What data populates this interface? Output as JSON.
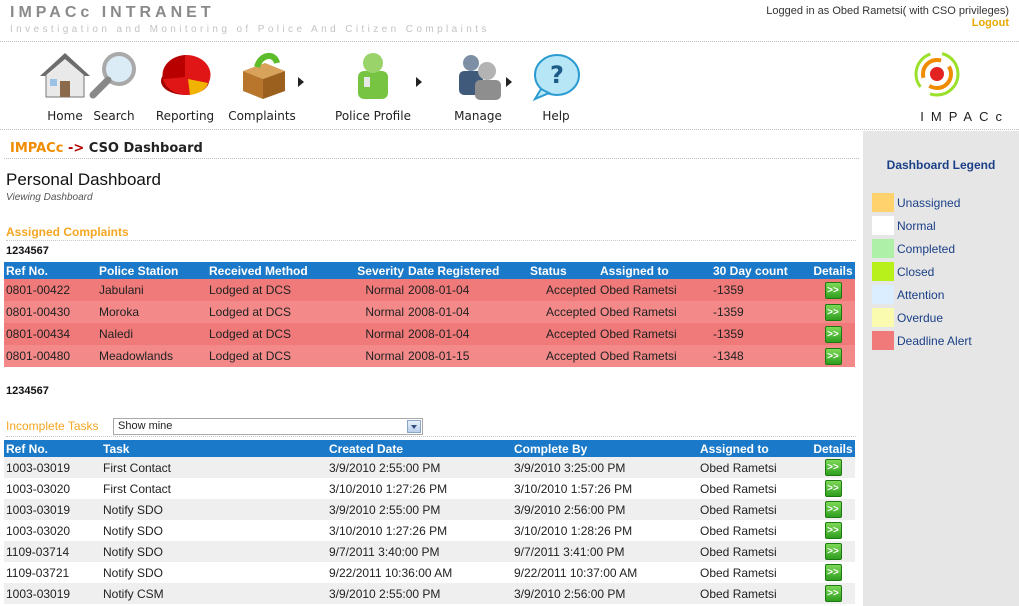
{
  "header": {
    "app_title": "IMPACc INTRANET",
    "app_subtitle": "Investigation and Monitoring of Police And Citizen Complaints",
    "login_info": "Logged in as Obed Rametsi( with CSO privileges)",
    "logout_label": "Logout"
  },
  "nav": {
    "items": [
      {
        "label": "Home",
        "icon": "house-icon"
      },
      {
        "label": "Search",
        "icon": "magnifier-icon"
      },
      {
        "label": "Reporting",
        "icon": "pie-chart-icon"
      },
      {
        "label": "Complaints",
        "icon": "box-icon"
      },
      {
        "label": "Police Profile",
        "icon": "officer-icon"
      },
      {
        "label": "Manage",
        "icon": "users-icon"
      },
      {
        "label": "Help",
        "icon": "help-bubble-icon"
      }
    ],
    "brand_text": "IMPACc"
  },
  "breadcrumb": {
    "root": "IMPACc",
    "arrow": "->",
    "current": "CSO Dashboard"
  },
  "page": {
    "title": "Personal Dashboard",
    "subtitle": "Viewing Dashboard"
  },
  "assigned": {
    "section_title": "Assigned Complaints",
    "pager_top": "1234567",
    "pager_bottom": "1234567",
    "columns": [
      "Ref No.",
      "Police Station",
      "Received Method",
      "Severity",
      "Date Registered",
      "Status",
      "Assigned to",
      "30 Day count",
      "Details"
    ],
    "rows": [
      {
        "ref": "0801-00422",
        "station": "Jabulani",
        "method": "Lodged at DCS",
        "severity": "Normal",
        "date": "2008-01-04",
        "status": "Accepted",
        "assigned": "Obed Rametsi",
        "count": "-1359",
        "details": ">>"
      },
      {
        "ref": "0801-00430",
        "station": "Moroka",
        "method": "Lodged at DCS",
        "severity": "Normal",
        "date": "2008-01-04",
        "status": "Accepted",
        "assigned": "Obed Rametsi",
        "count": "-1359",
        "details": ">>"
      },
      {
        "ref": "0801-00434",
        "station": "Naledi",
        "method": "Lodged at DCS",
        "severity": "Normal",
        "date": "2008-01-04",
        "status": "Accepted",
        "assigned": "Obed Rametsi",
        "count": "-1359",
        "details": ">>"
      },
      {
        "ref": "0801-00480",
        "station": "Meadowlands",
        "method": "Lodged at DCS",
        "severity": "Normal",
        "date": "2008-01-15",
        "status": "Accepted",
        "assigned": "Obed Rametsi",
        "count": "-1348",
        "details": ">>"
      }
    ]
  },
  "tasks": {
    "section_title": "Incomplete Tasks",
    "filter_value": "Show mine",
    "columns": [
      "Ref No.",
      "Task",
      "Created Date",
      "Complete By",
      "Assigned to",
      "Details"
    ],
    "rows": [
      {
        "ref": "1003-03019",
        "task": "First Contact",
        "created": "3/9/2010 2:55:00 PM",
        "complete_by": "3/9/2010 3:25:00 PM",
        "assigned": "Obed Rametsi",
        "details": ">>"
      },
      {
        "ref": "1003-03020",
        "task": "First Contact",
        "created": "3/10/2010 1:27:26 PM",
        "complete_by": "3/10/2010 1:57:26 PM",
        "assigned": "Obed Rametsi",
        "details": ">>"
      },
      {
        "ref": "1003-03019",
        "task": "Notify SDO",
        "created": "3/9/2010 2:55:00 PM",
        "complete_by": "3/9/2010 2:56:00 PM",
        "assigned": "Obed Rametsi",
        "details": ">>"
      },
      {
        "ref": "1003-03020",
        "task": "Notify SDO",
        "created": "3/10/2010 1:27:26 PM",
        "complete_by": "3/10/2010 1:28:26 PM",
        "assigned": "Obed Rametsi",
        "details": ">>"
      },
      {
        "ref": "1109-03714",
        "task": "Notify SDO",
        "created": "9/7/2011 3:40:00 PM",
        "complete_by": "9/7/2011 3:41:00 PM",
        "assigned": "Obed Rametsi",
        "details": ">>"
      },
      {
        "ref": "1109-03721",
        "task": "Notify SDO",
        "created": "9/22/2011 10:36:00 AM",
        "complete_by": "9/22/2011 10:37:00 AM",
        "assigned": "Obed Rametsi",
        "details": ">>"
      },
      {
        "ref": "1003-03019",
        "task": "Notify CSM",
        "created": "3/9/2010 2:55:00 PM",
        "complete_by": "3/9/2010 2:56:00 PM",
        "assigned": "Obed Rametsi",
        "details": ">>"
      }
    ]
  },
  "legend": {
    "title": "Dashboard Legend",
    "items": [
      {
        "label": "Unassigned",
        "color": "#ffd26e"
      },
      {
        "label": "Normal",
        "color": "#ffffff"
      },
      {
        "label": "Completed",
        "color": "#aef0a8"
      },
      {
        "label": "Closed",
        "color": "#b7f01a"
      },
      {
        "label": "Attention",
        "color": "#dbeeff"
      },
      {
        "label": "Overdue",
        "color": "#fbfbb0"
      },
      {
        "label": "Deadline Alert",
        "color": "#f07979"
      }
    ]
  }
}
